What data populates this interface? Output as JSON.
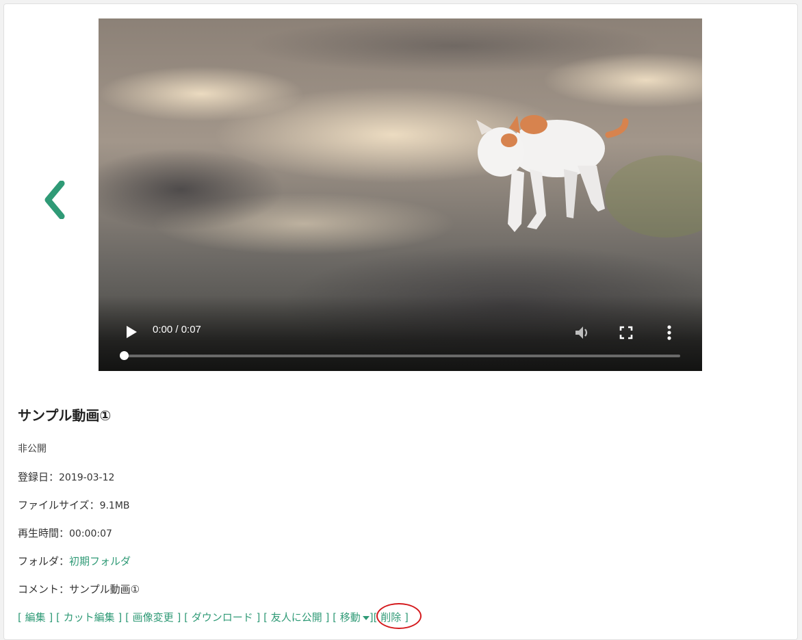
{
  "video": {
    "time": "0:00 / 0:07",
    "progress": 0.0
  },
  "media": {
    "title": "サンプル動画①",
    "visibility": "非公開",
    "registered_label": "登録日：",
    "registered_value": "2019-03-12",
    "filesize_label": "ファイルサイズ：",
    "filesize_value": "9.1MB",
    "duration_label": "再生時間：",
    "duration_value": "00:00:07",
    "folder_label": "フォルダ：",
    "folder_value": "初期フォルダ",
    "comment_label": "コメント：",
    "comment_value": "サンプル動画①"
  },
  "actions": {
    "edit": "[ 編集 ]",
    "cut_edit": "[ カット編集 ]",
    "change_image": "[ 画像変更 ]",
    "download": "[ ダウンロード ]",
    "share_friends": "[ 友人に公開 ]",
    "move_open": "[ 移動",
    "move_close": "]",
    "delete": "[ 削除 ]"
  },
  "colors": {
    "accent": "#2f9a76",
    "annotation": "#d4191c"
  },
  "icons": {
    "prev": "chevron-left-icon",
    "play": "play-icon",
    "mute": "volume-icon",
    "fullscreen": "fullscreen-icon",
    "menu": "more-vert-icon"
  }
}
